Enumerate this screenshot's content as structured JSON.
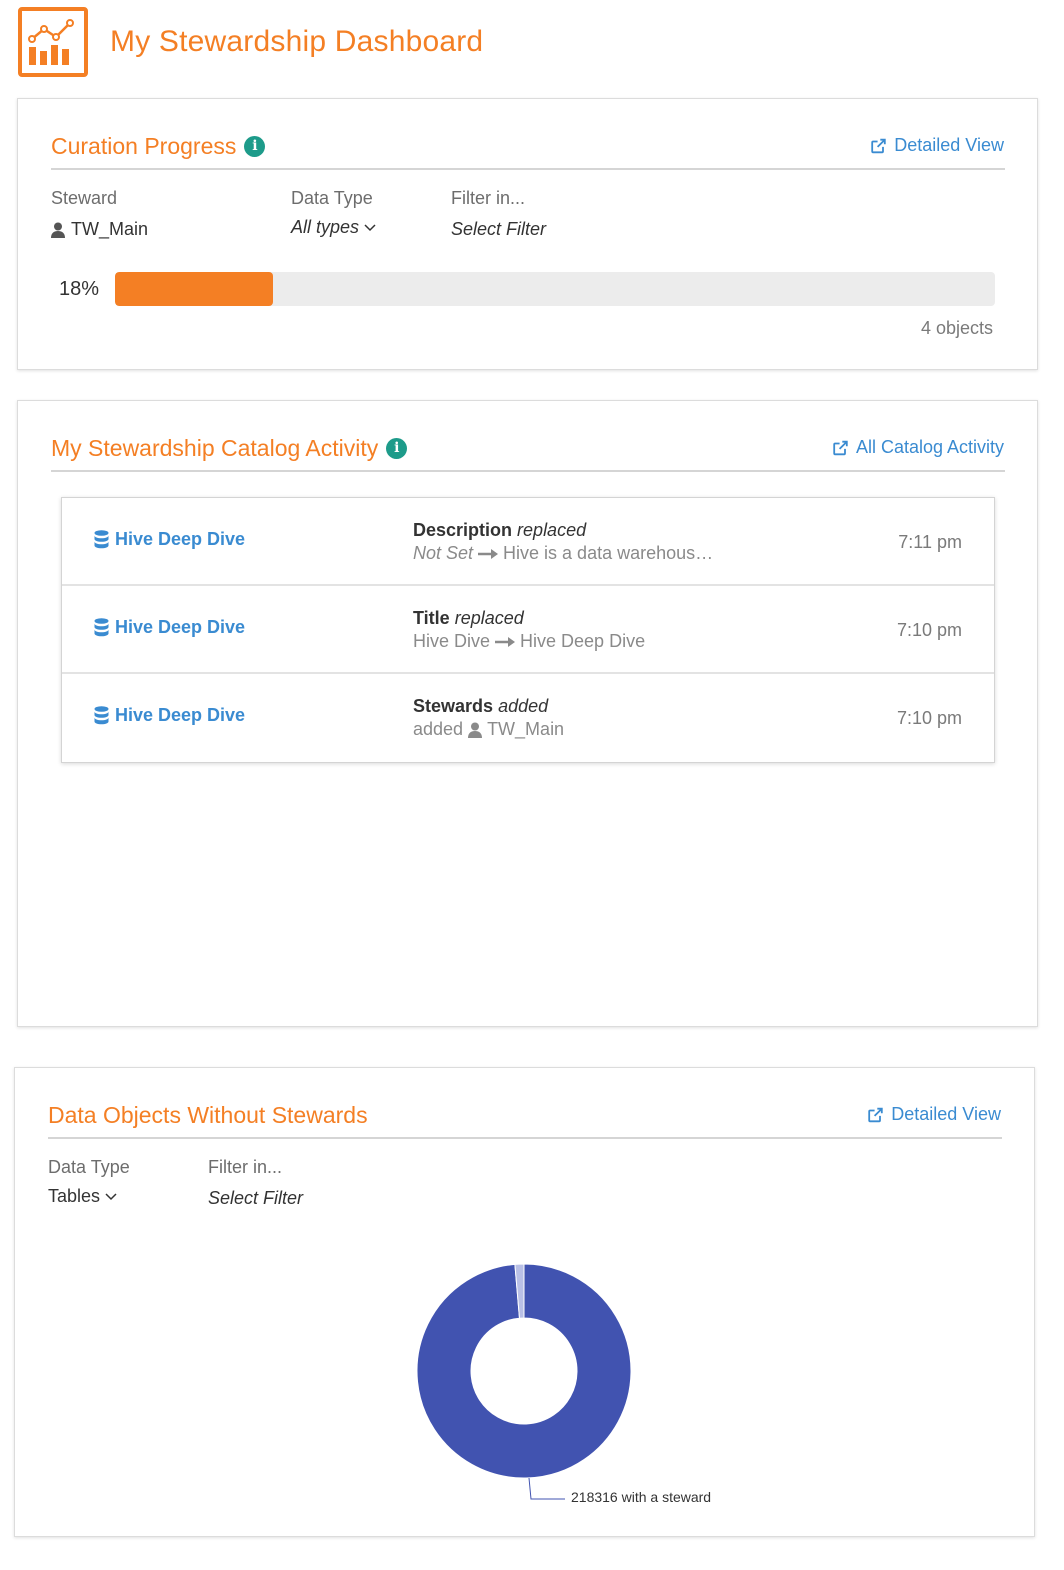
{
  "header": {
    "title": "My Stewardship Dashboard",
    "logo_icon": "bar-chart-icon"
  },
  "curation": {
    "title": "Curation Progress",
    "link": "Detailed View",
    "steward_label": "Steward",
    "steward_value": "TW_Main",
    "data_type_label": "Data Type",
    "data_type_value": "All types",
    "filter_label": "Filter in...",
    "filter_value": "Select Filter",
    "progress_text": "18%",
    "progress": 0.18,
    "objects": "4 objects"
  },
  "activity": {
    "title": "My Stewardship Catalog Activity",
    "link": "All Catalog Activity",
    "rows": [
      {
        "name": "Hive Deep Dive",
        "field": "Description",
        "action": "replaced",
        "from": "Not Set",
        "to": "Hive is a data warehous…",
        "time": "7:11 pm"
      },
      {
        "name": "Hive Deep Dive",
        "field": "Title",
        "action": "replaced",
        "from": "Hive Dive",
        "to": "Hive Deep Dive",
        "time": "7:10 pm"
      },
      {
        "name": "Hive Deep Dive",
        "field": "Stewards",
        "action": "added",
        "prefix": "added",
        "user": "TW_Main",
        "time": "7:10 pm"
      }
    ]
  },
  "no_stewards": {
    "title": "Data Objects Without Stewards",
    "link": "Detailed View",
    "data_type_label": "Data Type",
    "data_type_value": "Tables",
    "filter_label": "Filter in...",
    "filter_value": "Select Filter"
  },
  "chart_data": {
    "type": "pie",
    "donut": true,
    "slices": [
      {
        "label": "with a steward",
        "value": 218316,
        "color": "#4153b0"
      },
      {
        "label": "",
        "value": 3000,
        "color": "#b9c0e6"
      }
    ],
    "annotations": [
      "218316 with a steward"
    ]
  }
}
